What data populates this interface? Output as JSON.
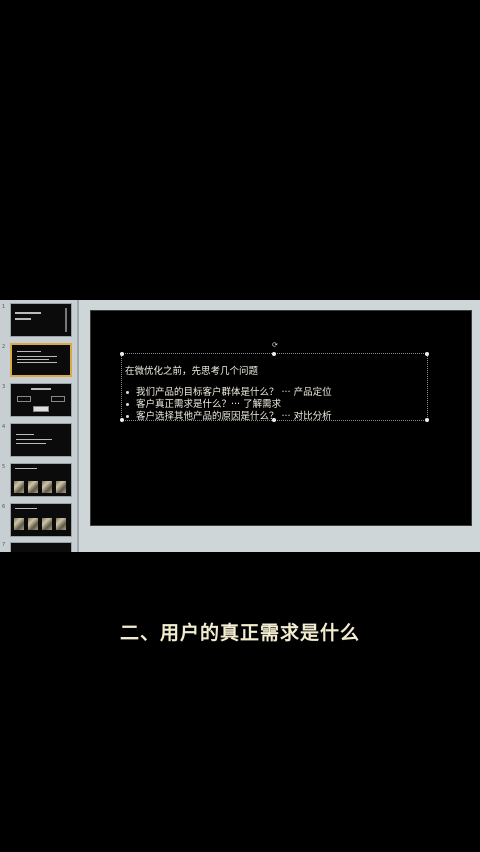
{
  "thumbnails": [
    {
      "number": "1",
      "title": "",
      "kind": "title"
    },
    {
      "number": "2",
      "title": "",
      "kind": "text",
      "active": true
    },
    {
      "number": "3",
      "title": "",
      "kind": "flow"
    },
    {
      "number": "4",
      "title": "",
      "kind": "text"
    },
    {
      "number": "5",
      "title": "",
      "kind": "images"
    },
    {
      "number": "6",
      "title": "",
      "kind": "images"
    },
    {
      "number": "7",
      "title": "",
      "kind": "partial"
    }
  ],
  "slide": {
    "title": "在微优化之前，先思考几个问题",
    "bullets": [
      "我们产品的目标客户群体是什么？ ···  产品定位",
      "客户真正需求是什么？···  了解需求",
      "客户选择其他产品的原因是什么？ ···  对比分析"
    ]
  },
  "subtitle": "二、用户的真正需求是什么"
}
